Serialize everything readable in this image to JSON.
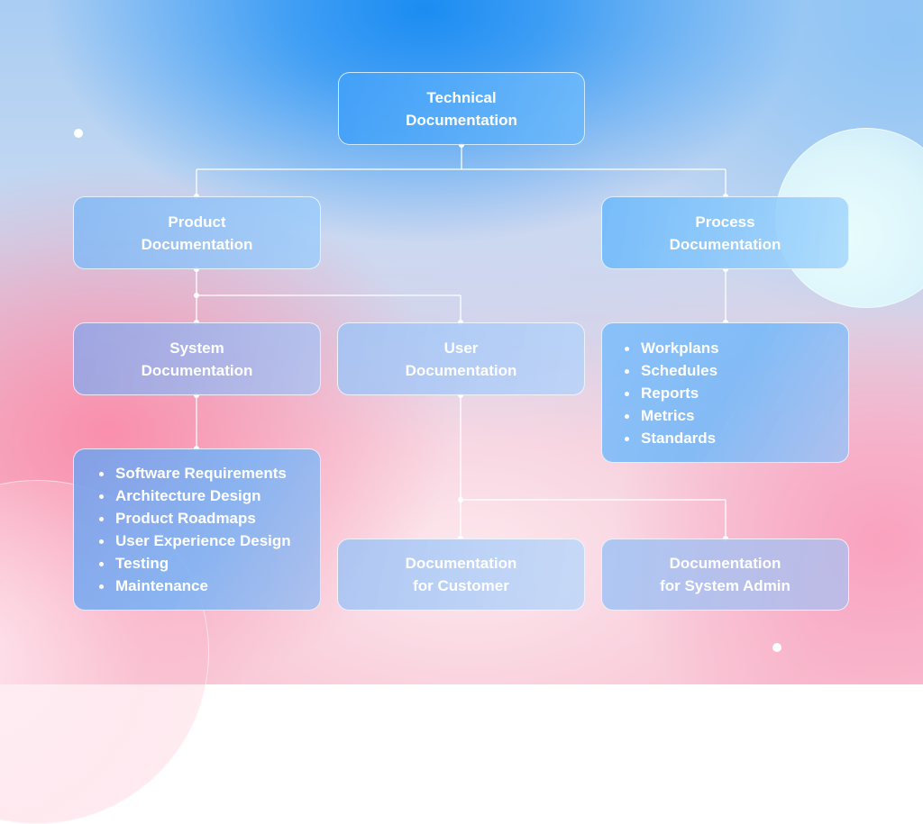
{
  "diagram": {
    "type": "hierarchy",
    "root": {
      "id": "technical",
      "lines": [
        "Technical",
        "Documentation"
      ]
    },
    "nodes": {
      "product": {
        "lines": [
          "Product",
          "Documentation"
        ],
        "parent": "technical"
      },
      "process": {
        "lines": [
          "Process",
          "Documentation"
        ],
        "parent": "technical"
      },
      "system": {
        "lines": [
          "System",
          "Documentation"
        ],
        "parent": "product"
      },
      "user": {
        "lines": [
          "User",
          "Documentation"
        ],
        "parent": "product"
      },
      "system_items": {
        "parent": "system",
        "items": [
          "Software Requirements",
          "Architecture Design",
          "Product Roadmaps",
          "User Experience Design",
          "Testing",
          "Maintenance"
        ]
      },
      "process_items": {
        "parent": "process",
        "items": [
          "Workplans",
          "Schedules",
          "Reports",
          "Metrics",
          "Standards"
        ]
      },
      "customer": {
        "lines": [
          "Documentation",
          "for Customer"
        ],
        "parent": "user"
      },
      "admin": {
        "lines": [
          "Documentation",
          "for System Admin"
        ],
        "parent": "user"
      }
    }
  },
  "colors": {
    "text": "#ffffff",
    "connector": "#ffffff",
    "background_top": "#1b8cf2",
    "background_bottom": "#f8c2d3"
  }
}
